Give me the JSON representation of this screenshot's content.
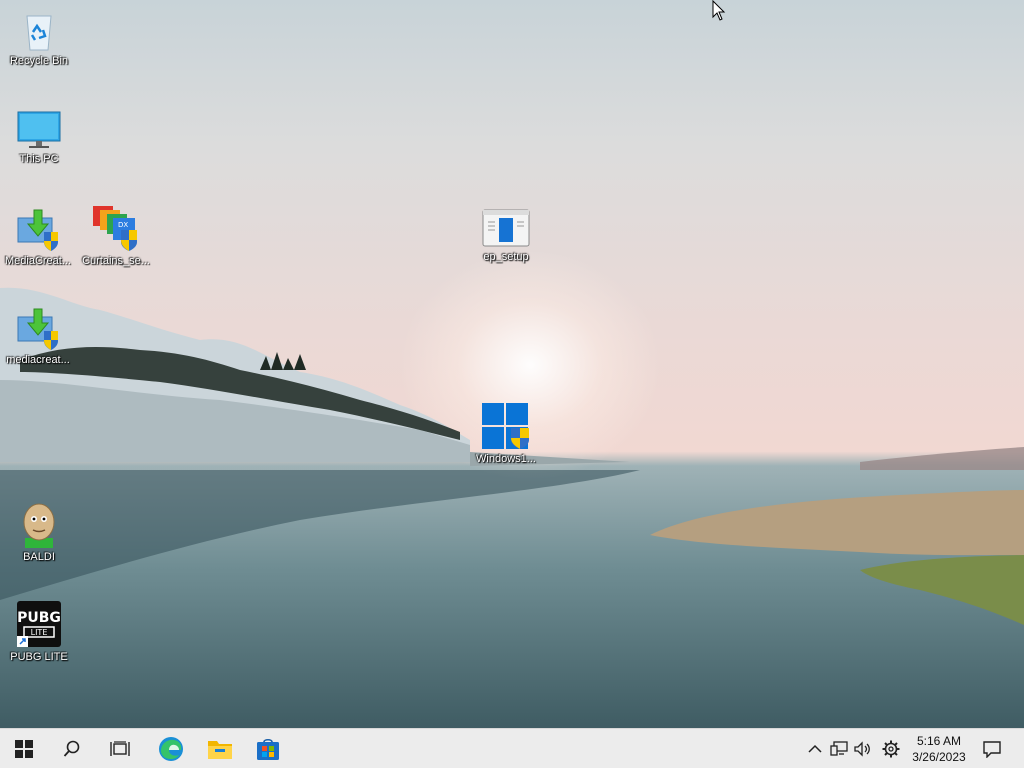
{
  "desktop": {
    "icons": [
      {
        "id": "recycle-bin",
        "label": "Recycle Bin",
        "icon": "recycle-bin-icon"
      },
      {
        "id": "this-pc",
        "label": "This PC",
        "icon": "monitor-icon"
      },
      {
        "id": "mediacreat-1",
        "label": "MediaCreat...",
        "icon": "installer-arrow-icon"
      },
      {
        "id": "curtains",
        "label": "Curtains_se...",
        "icon": "curtains-setup-icon"
      },
      {
        "id": "ep-setup",
        "label": "ep_setup",
        "icon": "window-app-icon"
      },
      {
        "id": "mediacreat-2",
        "label": "mediacreat...",
        "icon": "installer-arrow-icon"
      },
      {
        "id": "windows11",
        "label": "Windows1...",
        "icon": "windows-logo-shield-icon"
      },
      {
        "id": "baldi",
        "label": "BALDI",
        "icon": "baldi-head-icon"
      },
      {
        "id": "pubg",
        "label": "PUBG LITE",
        "icon": "pubg-lite-icon"
      }
    ]
  },
  "taskbar": {
    "buttons": [
      {
        "id": "start",
        "icon": "windows-start-icon"
      },
      {
        "id": "search",
        "icon": "search-icon"
      },
      {
        "id": "task-view",
        "icon": "task-view-icon"
      },
      {
        "id": "edge",
        "icon": "edge-browser-icon"
      },
      {
        "id": "explorer",
        "icon": "file-explorer-icon"
      },
      {
        "id": "store",
        "icon": "microsoft-store-icon"
      }
    ],
    "tray": {
      "icons": [
        "chevron-up-icon",
        "network-icon",
        "volume-icon",
        "settings-gear-icon"
      ],
      "time": "5:16 AM",
      "date": "3/26/2023",
      "notification_icon": "notification-icon"
    }
  },
  "colors": {
    "taskbar_bg": "#ececec",
    "accent_blue": "#0a74d6"
  }
}
